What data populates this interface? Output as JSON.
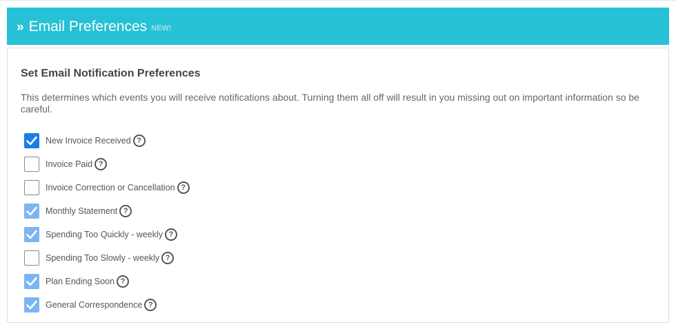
{
  "header": {
    "chevron_icon": "»",
    "title": "Email Preferences",
    "badge": "NEW!",
    "background_color": "#26c1d6"
  },
  "section": {
    "title": "Set Email Notification Preferences",
    "description": "This determines which events you will receive notifications about. Turning them all off will result in you missing out on important information so be careful."
  },
  "preferences": [
    {
      "label": "New Invoice Received",
      "checked": true,
      "help_icon": "question-circle-icon"
    },
    {
      "label": "Invoice Paid",
      "checked": false,
      "help_icon": "question-circle-icon"
    },
    {
      "label": "Invoice Correction or Cancellation",
      "checked": false,
      "help_icon": "question-circle-icon"
    },
    {
      "label": "Monthly Statement",
      "checked": true,
      "help_icon": "question-circle-icon"
    },
    {
      "label": "Spending Too Quickly - weekly",
      "checked": true,
      "help_icon": "question-circle-icon"
    },
    {
      "label": "Spending Too Slowly - weekly",
      "checked": false,
      "help_icon": "question-circle-icon"
    },
    {
      "label": "Plan Ending Soon",
      "checked": true,
      "help_icon": "question-circle-icon"
    },
    {
      "label": "General Correspondence",
      "checked": true,
      "help_icon": "question-circle-icon"
    }
  ],
  "colors": {
    "checkbox_active": "#1a7ee6",
    "checkbox_checked": "#7cb6f2"
  }
}
